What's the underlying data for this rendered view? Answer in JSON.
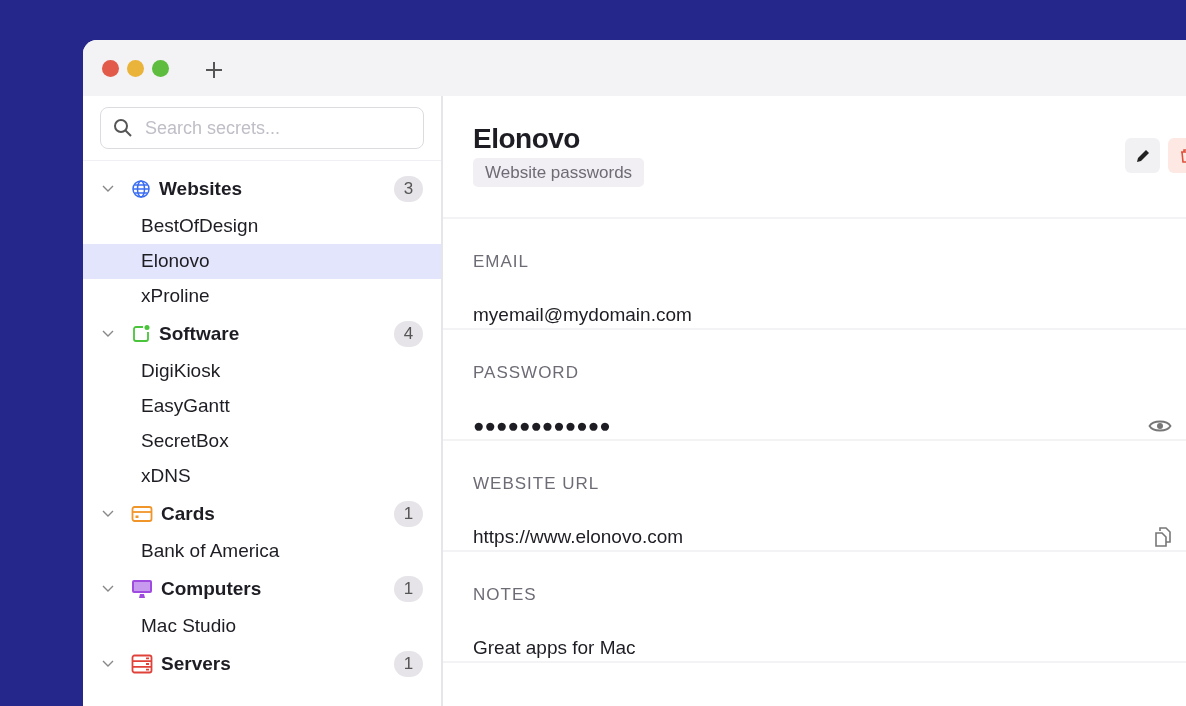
{
  "search": {
    "placeholder": "Search secrets..."
  },
  "categories": [
    {
      "name": "Websites",
      "kind": "globe",
      "count": "3",
      "expanded": true,
      "children": [
        {
          "label": "BestOfDesign",
          "selected": false
        },
        {
          "label": "Elonovo",
          "selected": true
        },
        {
          "label": "xProline",
          "selected": false
        }
      ]
    },
    {
      "name": "Software",
      "kind": "app",
      "count": "4",
      "expanded": true,
      "children": [
        {
          "label": "DigiKiosk",
          "selected": false
        },
        {
          "label": "EasyGantt",
          "selected": false
        },
        {
          "label": "SecretBox",
          "selected": false
        },
        {
          "label": "xDNS",
          "selected": false
        }
      ]
    },
    {
      "name": "Cards",
      "kind": "card",
      "count": "1",
      "expanded": true,
      "children": [
        {
          "label": "Bank of America",
          "selected": false
        }
      ]
    },
    {
      "name": "Computers",
      "kind": "computer",
      "count": "1",
      "expanded": true,
      "children": [
        {
          "label": "Mac Studio",
          "selected": false
        }
      ]
    },
    {
      "name": "Servers",
      "kind": "server",
      "count": "1",
      "expanded": true
    }
  ],
  "detail": {
    "title": "Elonovo",
    "tag": "Website passwords",
    "fields": [
      {
        "label": "EMAIL",
        "value": "myemail@mydomain.com",
        "kind": "plain"
      },
      {
        "label": "PASSWORD",
        "value": "●●●●●●●●●●●●",
        "kind": "secret"
      },
      {
        "label": "WEBSITE URL",
        "value": "https://www.elonovo.com",
        "kind": "link"
      },
      {
        "label": "NOTES",
        "value": "Great apps for Mac",
        "kind": "plain"
      }
    ]
  }
}
